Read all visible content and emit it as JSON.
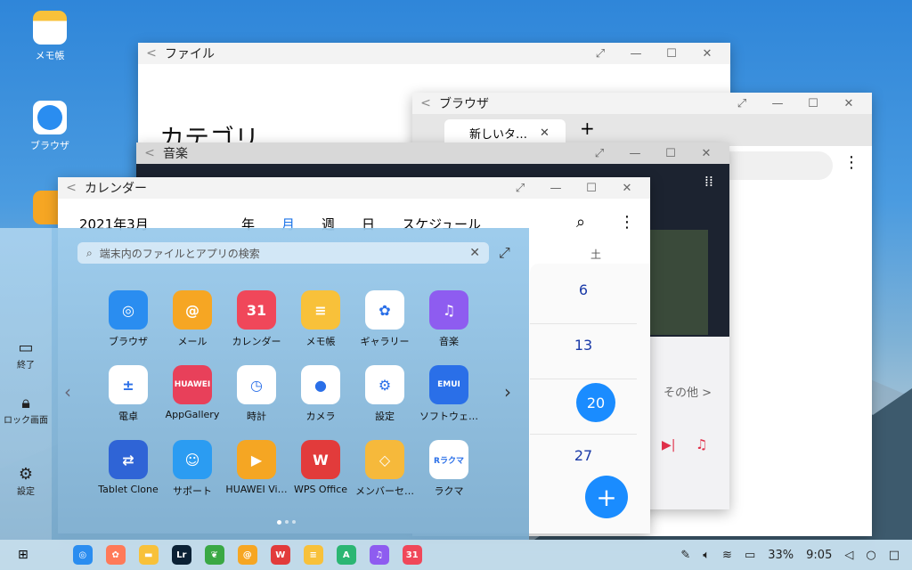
{
  "desktop": {
    "icons": [
      {
        "label": "メモ帳"
      },
      {
        "label": "ブラウザ"
      }
    ]
  },
  "windows": {
    "files": {
      "title": "ファイル",
      "heading": "カテゴリ"
    },
    "browser": {
      "title": "ブラウザ",
      "tab_label": "新しいタ…",
      "new_tab": "+"
    },
    "music": {
      "title": "音楽",
      "more_label": "その他 >"
    },
    "calendar": {
      "title": "カレンダー",
      "month": "2021年3月",
      "views": [
        "年",
        "月",
        "週",
        "日",
        "スケジュール"
      ],
      "weekday": "土",
      "dates": [
        "6",
        "13",
        "20",
        "27"
      ],
      "selected_date": "20",
      "fab": "+"
    }
  },
  "launcher": {
    "search_placeholder": "端末内のファイルとアプリの検索",
    "left_buttons": [
      "終了",
      "ロック画面",
      "設定"
    ],
    "apps": [
      {
        "label": "ブラウザ",
        "color": "#2a8df0",
        "glyph": "◎"
      },
      {
        "label": "メール",
        "color": "#f6a623",
        "glyph": "@"
      },
      {
        "label": "カレンダー",
        "color": "#f0475a",
        "glyph": "31"
      },
      {
        "label": "メモ帳",
        "color": "#f8c13a",
        "glyph": "≡"
      },
      {
        "label": "ギャラリー",
        "color": "#ffffff",
        "glyph": "✿"
      },
      {
        "label": "音楽",
        "color": "#8e5cf0",
        "glyph": "♫"
      },
      {
        "label": "電卓",
        "color": "#ffffff",
        "glyph": "±"
      },
      {
        "label": "AppGallery",
        "color": "#e8405a",
        "glyph": "HUAWEI"
      },
      {
        "label": "時計",
        "color": "#ffffff",
        "glyph": "◷"
      },
      {
        "label": "カメラ",
        "color": "#ffffff",
        "glyph": "●"
      },
      {
        "label": "設定",
        "color": "#ffffff",
        "glyph": "⚙"
      },
      {
        "label": "ソフトウェ…",
        "color": "#2a6fe8",
        "glyph": "EMUI"
      },
      {
        "label": "Tablet Clone",
        "color": "#2f64d6",
        "glyph": "⇄"
      },
      {
        "label": "サポート",
        "color": "#2b9cf2",
        "glyph": "☺"
      },
      {
        "label": "HUAWEI Vi…",
        "color": "#f5a623",
        "glyph": "▶"
      },
      {
        "label": "WPS Office",
        "color": "#e23b3b",
        "glyph": "W"
      },
      {
        "label": "メンバーセ…",
        "color": "#f6b93b",
        "glyph": "◇"
      },
      {
        "label": "ラクマ",
        "color": "#ffffff",
        "glyph": "Rラクマ"
      }
    ]
  },
  "taskbar": {
    "battery": "33%",
    "time": "9:05",
    "apps": [
      {
        "name": "browser",
        "color": "#2a8df0",
        "glyph": "◎"
      },
      {
        "name": "gallery",
        "color": "#ff7a59",
        "glyph": "✿"
      },
      {
        "name": "files",
        "color": "#f8c13a",
        "glyph": "▬"
      },
      {
        "name": "lightroom",
        "color": "#0b2135",
        "glyph": "Lr"
      },
      {
        "name": "snapseed",
        "color": "#3aa844",
        "glyph": "❦"
      },
      {
        "name": "mail",
        "color": "#f6a623",
        "glyph": "@"
      },
      {
        "name": "wps",
        "color": "#e23b3b",
        "glyph": "W"
      },
      {
        "name": "notepad",
        "color": "#f8c13a",
        "glyph": "≡"
      },
      {
        "name": "appstore",
        "color": "#2bb673",
        "glyph": "A"
      },
      {
        "name": "music",
        "color": "#8e5cf0",
        "glyph": "♫"
      },
      {
        "name": "calendar",
        "color": "#f0475a",
        "glyph": "31"
      }
    ]
  }
}
